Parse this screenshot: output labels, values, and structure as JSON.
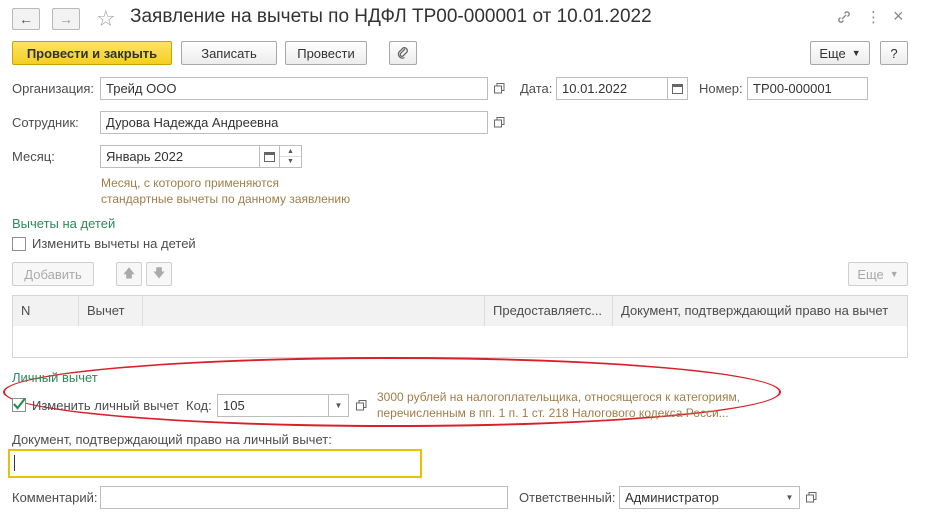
{
  "window": {
    "title": "Заявление на вычеты по НДФЛ ТР00-000001 от 10.01.2022"
  },
  "toolbar": {
    "post_close": "Провести и закрыть",
    "save": "Записать",
    "post": "Провести",
    "more": "Еще",
    "help": "?"
  },
  "form": {
    "org_label": "Организация:",
    "org_value": "Трейд ООО",
    "date_label": "Дата:",
    "date_value": "10.01.2022",
    "number_label": "Номер:",
    "number_value": "ТР00-000001",
    "employee_label": "Сотрудник:",
    "employee_value": "Дурова Надежда Андреевна",
    "month_label": "Месяц:",
    "month_value": "Январь 2022",
    "month_hint_1": "Месяц, с которого применяются",
    "month_hint_2": "стандартные вычеты по данному заявлению"
  },
  "children": {
    "title": "Вычеты на детей",
    "change_label": "Изменить вычеты на детей",
    "add": "Добавить",
    "more": "Еще",
    "columns": [
      "N",
      "Вычет",
      "",
      "Предоставляетс...",
      "Документ, подтверждающий право на вычет"
    ]
  },
  "personal": {
    "title": "Личный вычет",
    "change_label": "Изменить личный вычет",
    "code_label": "Код:",
    "code_value": "105",
    "hint_1": "3000 рублей на налогоплательщика, относящегося к категориям,",
    "hint_2": "перечисленным в пп. 1 п. 1 ст. 218 Налогового кодекса Росси..."
  },
  "doc": {
    "label": "Документ, подтверждающий право на личный вычет:",
    "value": ""
  },
  "footer": {
    "comment_label": "Комментарий:",
    "comment_value": "",
    "responsible_label": "Ответственный:",
    "responsible_value": "Администратор"
  },
  "colors": {
    "accent_yellow": "#f4cf1e",
    "group_green": "#2e8b57",
    "hint_brown": "#a07d4a",
    "highlight_red": "#d9202a",
    "focus_border": "#e8c200"
  }
}
